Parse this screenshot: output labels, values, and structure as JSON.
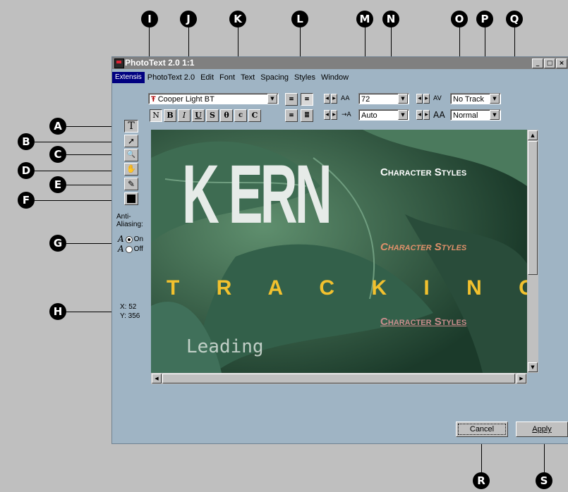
{
  "window": {
    "title": "PhotoText 2.0 1:1",
    "controls": [
      "_",
      "□",
      "×"
    ]
  },
  "menubar": {
    "items": [
      "Extensis",
      "PhotoText 2.0",
      "Edit",
      "Font",
      "Text",
      "Spacing",
      "Styles",
      "Window"
    ]
  },
  "toolbar": {
    "font_name": "Cooper Light BT",
    "font_icon": "Ŧ",
    "style_buttons": [
      "N",
      "B",
      "I",
      "U",
      "S",
      "θ",
      "c",
      "C"
    ],
    "size_value": "72",
    "leading_value": "Auto",
    "tracking_value": "No Track",
    "kerning_value": "Normal",
    "size_glyph": "AA",
    "leading_glyph": "→A",
    "tracking_glyph": "AV",
    "kerning_glyph": "AA"
  },
  "tools": {
    "text": "T",
    "select": "➚",
    "zoom": "🔍",
    "hand": "✋",
    "eyedropper": "✎"
  },
  "anti_aliasing": {
    "label_line1": "Anti-",
    "label_line2": "Aliasing:",
    "on_label": "On",
    "off_label": "Off",
    "selected": "On"
  },
  "coords": {
    "x": "X: 52",
    "y": "Y: 356"
  },
  "canvas": {
    "kern_text": "K ERN",
    "tracking_text": "T R A C K I N G",
    "leading_text": "Leading",
    "style_white": "Character Styles",
    "style_italic": "Character Styles",
    "style_underline": "Character Styles"
  },
  "buttons": {
    "cancel": "Cancel",
    "apply": "Apply"
  },
  "callouts": [
    "A",
    "B",
    "C",
    "D",
    "E",
    "F",
    "G",
    "H",
    "I",
    "J",
    "K",
    "L",
    "M",
    "N",
    "O",
    "P",
    "Q",
    "R",
    "S"
  ],
  "colors": {
    "badge": "#000000",
    "window_bg": "#9fb4c4",
    "menu_highlight": "#000080",
    "tracking_yellow": "#f2c12e",
    "italic_orange": "#e0906a"
  }
}
